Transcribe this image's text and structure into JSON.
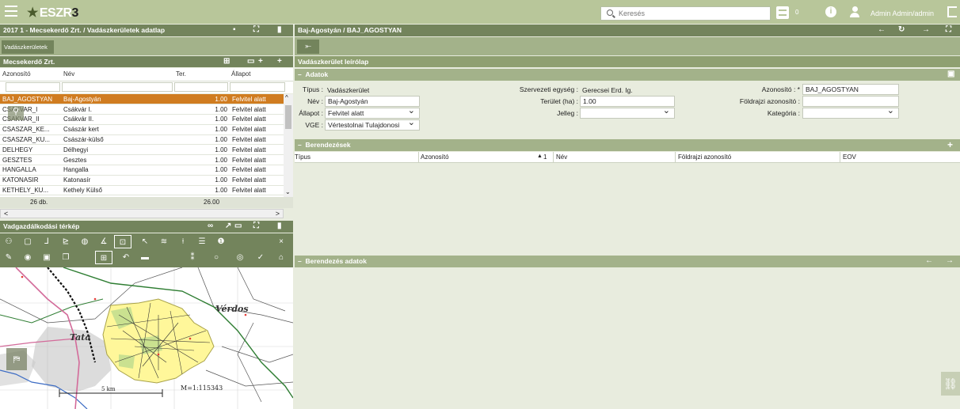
{
  "topbar": {
    "logo_text": "ESZR",
    "logo_num": "3",
    "search_placeholder": "Keresés",
    "notif_count": "0",
    "user_name": "Admin Admin/admin"
  },
  "left": {
    "title": "2017 1 - Mecsekerdő Zrt. / Vadászkerületek adatlap",
    "tab_label": "Vadászkerületek",
    "org_title": "Mecsekerdő Zrt.",
    "columns": [
      "Azonosító",
      "Név",
      "Ter.",
      "Állapot"
    ],
    "rows": [
      {
        "id": "BAJ_AGOSTYAN",
        "name": "Baj-Agostyán",
        "area": "1.00",
        "status": "Felvitel alatt"
      },
      {
        "id": "CSAKVAR_I",
        "name": "Csákvár I.",
        "area": "1.00",
        "status": "Felvitel alatt"
      },
      {
        "id": "CSAKVAR_II",
        "name": "Csákvár II.",
        "area": "1.00",
        "status": "Felvitel alatt"
      },
      {
        "id": "CSASZAR_KE...",
        "name": "Császár kert",
        "area": "1.00",
        "status": "Felvitel alatt"
      },
      {
        "id": "CSASZAR_KU...",
        "name": "Császár-külső",
        "area": "1.00",
        "status": "Felvitel alatt"
      },
      {
        "id": "DELHEGY",
        "name": "Délhegyi",
        "area": "1.00",
        "status": "Felvitel alatt"
      },
      {
        "id": "GESZTES",
        "name": "Gesztes",
        "area": "1.00",
        "status": "Felvitel alatt"
      },
      {
        "id": "HANGALLA",
        "name": "Hangalla",
        "area": "1.00",
        "status": "Felvitel alatt"
      },
      {
        "id": "KATONASIR",
        "name": "Katonasír",
        "area": "1.00",
        "status": "Felvitel alatt"
      },
      {
        "id": "KETHELY_KU...",
        "name": "Kethely Külső",
        "area": "1.00",
        "status": "Felvitel alatt"
      }
    ],
    "footer_count": "26 db.",
    "footer_sum": "26.00",
    "map_title": "Vadgazdálkodási térkép",
    "map": {
      "town1": "Tata",
      "town2": "Vérdos",
      "scale_label": "5 km",
      "ratio_label": "M=1:115343"
    }
  },
  "right": {
    "breadcrumb": "Baj-Agostyán / BAJ_AGOSTYAN",
    "sheet_title": "Vadászkerület leírólap",
    "section_data": "Adatok",
    "fields": {
      "type_label": "Típus :",
      "type_value": "Vadászkerület",
      "name_label": "Név :",
      "name_value": "Baj-Agostyán",
      "state_label": "Állapot :",
      "state_value": "Felvitel alatt",
      "vge_label": "VGE :",
      "vge_value": "Vértestolnai Tulajdonosi",
      "org_label": "Szervezeti egység :",
      "org_value": "Gerecsei Erd. Ig.",
      "area_label": "Terület (ha) :",
      "area_value": "1.00",
      "character_label": "Jelleg :",
      "character_value": "",
      "id_label": "Azonosító : *",
      "id_value": "BAJ_AGOSTYAN",
      "geo_label": "Földrajzi azonosító :",
      "geo_value": "",
      "category_label": "Kategória :",
      "category_value": ""
    },
    "section_equipment": "Berendezések",
    "equip_columns": [
      "Típus",
      "Azonosító",
      "1",
      "Név",
      "Földrajzi azonosító",
      "EOV"
    ],
    "section_equipment_data": "Berendezés adatok"
  },
  "colors": {
    "topbar": "#b8c69a",
    "header": "#73845c",
    "selected_row": "#d07c20",
    "polygon_fill": "#fff79a"
  }
}
